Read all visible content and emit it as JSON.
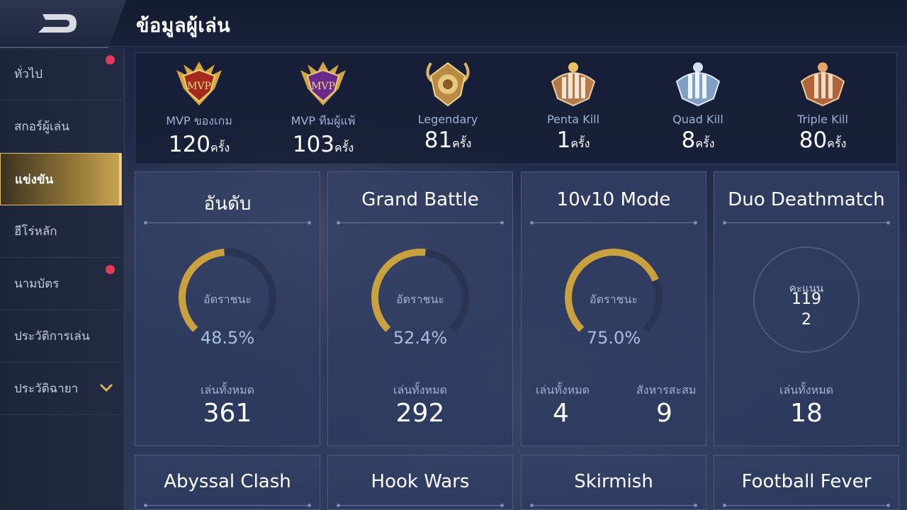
{
  "header": {
    "title": "ข้อมูลผู้เล่น"
  },
  "sidebar": {
    "items": [
      {
        "label": "ทั่วไป"
      },
      {
        "label": "สกอร์ผู้เล่น"
      },
      {
        "label": "แข่งขัน"
      },
      {
        "label": "ฮีโร่หลัก"
      },
      {
        "label": "นามบัตร"
      },
      {
        "label": "ประวัติการเล่น"
      },
      {
        "label": "ประวัติฉายา"
      }
    ]
  },
  "achievements": [
    {
      "label": "MVP ของเกม",
      "value": "120",
      "unit": "ครั้ง",
      "icon": "mvp-gold-medal-icon",
      "badge_text": "MVP"
    },
    {
      "label": "MVP ทีมผู้แพ้",
      "value": "103",
      "unit": "ครั้ง",
      "icon": "mvp-purple-medal-icon",
      "badge_text": "MVP"
    },
    {
      "label": "Legendary",
      "value": "81",
      "unit": "ครั้ง",
      "icon": "legendary-medal-icon"
    },
    {
      "label": "Penta Kill",
      "value": "1",
      "unit": "ครั้ง",
      "icon": "penta-kill-medal-icon"
    },
    {
      "label": "Quad Kill",
      "value": "8",
      "unit": "ครั้ง",
      "icon": "quad-kill-medal-icon"
    },
    {
      "label": "Triple Kill",
      "value": "80",
      "unit": "ครั้ง",
      "icon": "triple-kill-medal-icon"
    }
  ],
  "modes": [
    {
      "title": "อันดับ",
      "gauge_label": "อัตราชนะ",
      "win_rate": "48.5%",
      "win_fraction": 0.485,
      "total_label": "เล่นทั้งหมด",
      "total": "361"
    },
    {
      "title": "Grand Battle",
      "gauge_label": "อัตราชนะ",
      "win_rate": "52.4%",
      "win_fraction": 0.524,
      "total_label": "เล่นทั้งหมด",
      "total": "292"
    },
    {
      "title": "10v10 Mode",
      "gauge_label": "อัตราชนะ",
      "win_rate": "75.0%",
      "win_fraction": 0.75,
      "total_label": "เล่นทั้งหมด",
      "total": "4",
      "extra_label": "สังหารสะสม",
      "extra": "9"
    },
    {
      "title": "Duo Deathmatch",
      "score_label": "คะแนน",
      "score": "119",
      "score2": "2",
      "total_label": "เล่นทั้งหมด",
      "total": "18"
    },
    {
      "title": "Abyssal Clash"
    },
    {
      "title": "Hook Wars"
    },
    {
      "title": "Skirmish"
    },
    {
      "title": "Football Fever"
    }
  ],
  "colors": {
    "accent_gold": "#c9a13f",
    "gauge_track": "#2b3552",
    "notify_dot": "#e43a57"
  }
}
